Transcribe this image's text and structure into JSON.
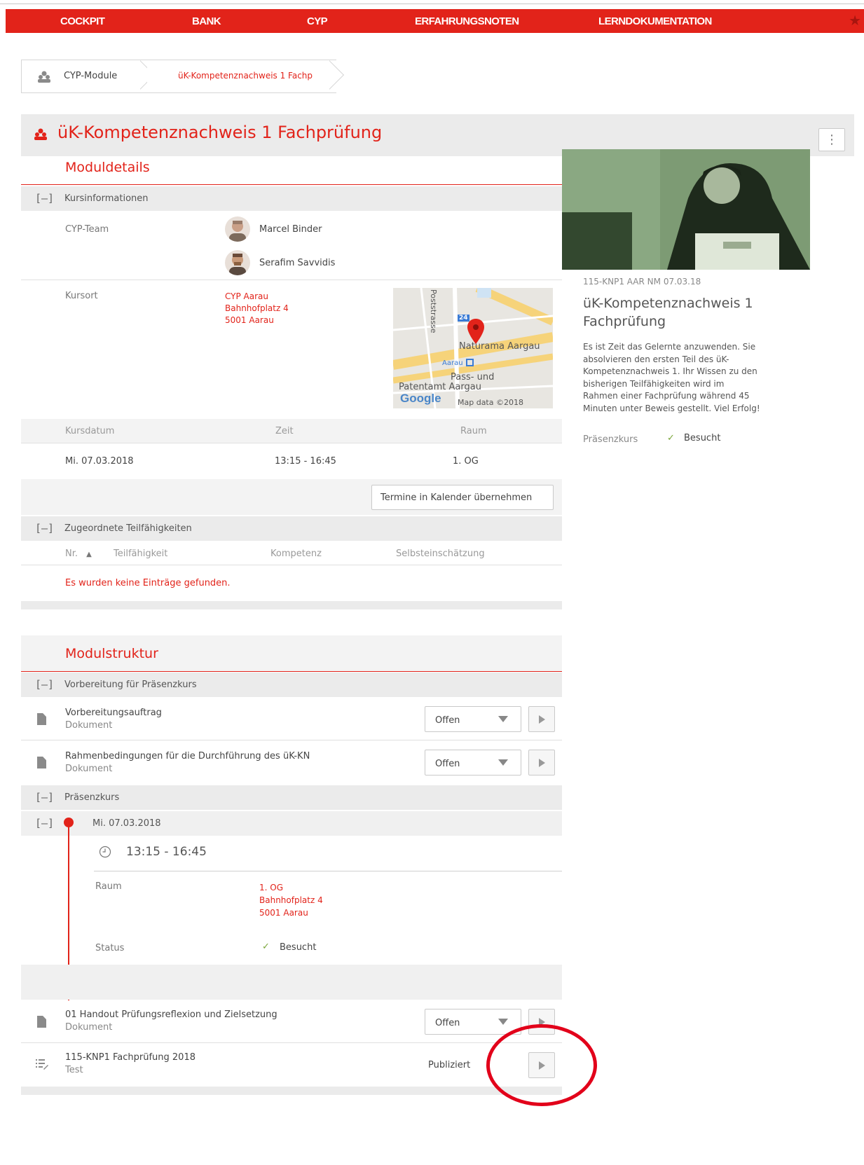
{
  "nav": {
    "items": [
      "COCKPIT",
      "BANK",
      "CYP",
      "ERFAHRUNGSNOTEN",
      "LERNDOKUMENTATION"
    ],
    "favorite_icon": "star-icon"
  },
  "breadcrumb": {
    "items": [
      "CYP-Module",
      "üK-Kompetenznachweis 1 Fachp"
    ]
  },
  "module": {
    "title": "üK-Kompetenznachweis 1 Fachprüfung",
    "menu_icon": "⋮"
  },
  "details": {
    "heading": "Moduldetails",
    "kurs_section": "Kursinformationen",
    "team_label": "CYP-Team",
    "team": [
      "Marcel Binder",
      "Serafim Savvidis"
    ],
    "kursort_label": "Kursort",
    "kursort": [
      "CYP Aarau",
      "Bahnhofplatz 4",
      "5001 Aarau"
    ],
    "map": {
      "street": "Poststrasse",
      "road_badge": "24",
      "poi1": "Naturama Aargau",
      "station": "Aarau",
      "poi2_line1": "Pass- und",
      "poi2_line2": "Patentamt Aargau",
      "logo": "Google",
      "credit": "Map data ©2018 Google"
    },
    "table": {
      "headers": [
        "Kursdatum",
        "Zeit",
        "Raum"
      ],
      "row": [
        "Mi. 07.03.2018",
        "13:15 - 16:45",
        "1. OG"
      ]
    },
    "calendar_button": "Termine in Kalender übernehmen",
    "skills_section": "Zugeordnete Teilfähigkeiten",
    "skills_headers": [
      "Nr.",
      "Teilfähigkeit",
      "Kompetenz",
      "Selbsteinschätzung"
    ],
    "sort_icon": "▲",
    "empty_message": "Es wurden keine Einträge gefunden."
  },
  "sidebar": {
    "code": "115-KNP1 AAR NM 07.03.18",
    "title_line1": "üK-Kompetenznachweis 1",
    "title_line2": "Fachprüfung",
    "description": [
      "Es ist Zeit das Gelernte anzuwenden. Sie",
      "absolvieren den ersten Teil des üK-",
      "Kompetenznachweis 1. Ihr Wissen zu den",
      "bisherigen Teilfähigkeiten wird im",
      "Rahmen einer Fachprüfung während 45",
      "Minuten unter Beweis gestellt. Viel Erfolg!"
    ],
    "status_label": "Präsenzkurs",
    "status_value": "Besucht"
  },
  "structure": {
    "heading": "Modulstruktur",
    "section1": "Vorbereitung für Präsenzkurs",
    "items1": [
      {
        "title": "Vorbereitungsauftrag",
        "type": "Dokument",
        "status": "Offen"
      },
      {
        "title": "Rahmenbedingungen für die Durchführung des üK-KN",
        "type": "Dokument",
        "status": "Offen"
      }
    ],
    "section2": "Präsenzkurs",
    "date": "Mi. 07.03.2018",
    "time": "13:15 - 16:45",
    "raum_label": "Raum",
    "raum": [
      "1. OG",
      "Bahnhofplatz 4",
      "5001 Aarau"
    ],
    "status_label": "Status",
    "status_value": "Besucht",
    "items2": [
      {
        "title": "01 Handout Prüfungsreflexion und Zielsetzung",
        "type": "Dokument",
        "status": "Offen"
      },
      {
        "title": "115-KNP1 Fachprüfung 2018",
        "type": "Test",
        "status": "Publiziert"
      }
    ]
  },
  "colors": {
    "accent": "#e2231a",
    "panel_gray": "#ebebeb",
    "check": "#7aa63a"
  }
}
